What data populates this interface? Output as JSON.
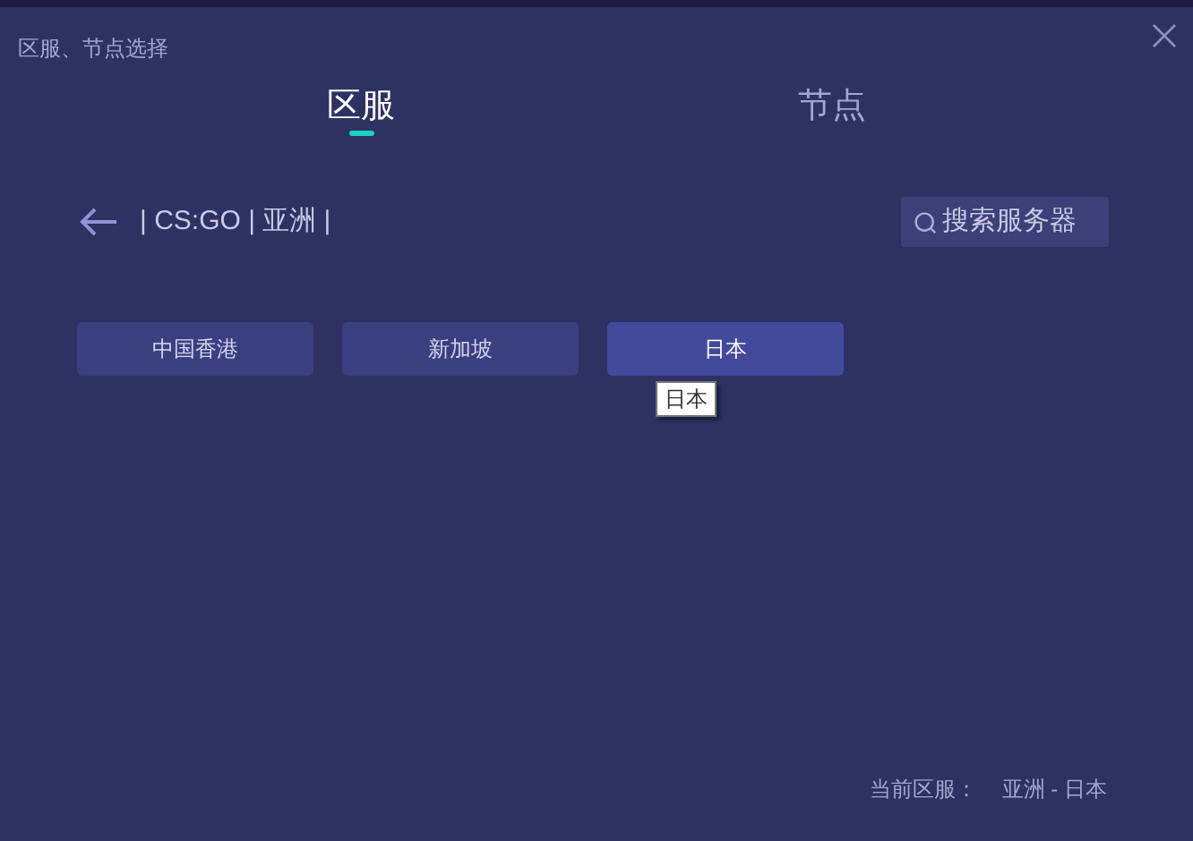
{
  "window": {
    "title": "区服、节点选择"
  },
  "tabs": [
    {
      "label": "区服",
      "selected": true
    },
    {
      "label": "节点",
      "selected": false
    }
  ],
  "breadcrumb": "| CS:GO | 亚洲 |",
  "search": {
    "placeholder": "搜索服务器"
  },
  "servers": [
    {
      "label": "中国香港",
      "selected": false
    },
    {
      "label": "新加坡",
      "selected": false
    },
    {
      "label": "日本",
      "selected": true
    }
  ],
  "tooltip": "日本",
  "status": {
    "label": "当前区服：",
    "value": "亚洲 - 日本"
  }
}
